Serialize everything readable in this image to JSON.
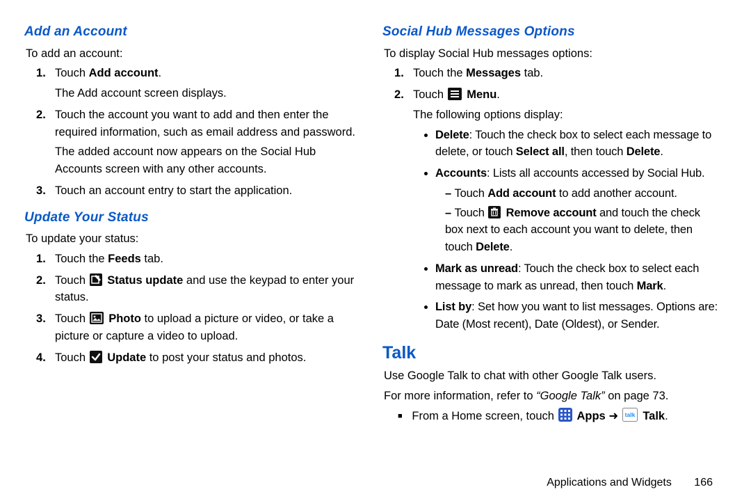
{
  "left": {
    "h_add_account": "Add an Account",
    "add_intro": "To add an account:",
    "add_1a": "Touch ",
    "add_1b": "Add account",
    "add_1c": ".",
    "add_1_follow": "The Add account screen displays.",
    "add_2": "Touch the account you want to add and then enter the required information, such as email address and password.",
    "add_2_follow": "The added account now appears on the Social Hub Accounts screen with any other accounts.",
    "add_3": "Touch an account entry to start the application.",
    "h_update": "Update Your Status",
    "upd_intro": "To update your status:",
    "upd_1a": "Touch the ",
    "upd_1b": "Feeds",
    "upd_1c": " tab.",
    "upd_2a": "Touch ",
    "upd_2b": " Status update",
    "upd_2c": " and use the keypad to enter your status.",
    "upd_3a": "Touch ",
    "upd_3b": " Photo",
    "upd_3c": " to upload a picture or video, or take a picture or capture a video to upload.",
    "upd_4a": "Touch ",
    "upd_4b": " Update",
    "upd_4c": " to post your status and photos."
  },
  "right": {
    "h_social": "Social Hub Messages Options",
    "soc_intro": "To display Social Hub messages options:",
    "soc_1a": "Touch the ",
    "soc_1b": "Messages",
    "soc_1c": " tab.",
    "soc_2a": "Touch ",
    "soc_2b": " Menu",
    "soc_2c": ".",
    "soc_2_follow": "The following options display:",
    "b_del_a": "Delete",
    "b_del_b": ": Touch the check box to select each message to delete, or touch ",
    "b_del_c": "Select all",
    "b_del_d": ", then touch ",
    "b_del_e": "Delete",
    "b_del_f": ".",
    "b_acc_a": "Accounts",
    "b_acc_b": ": Lists all accounts accessed by Social Hub.",
    "d_add_a": "Touch ",
    "d_add_b": "Add account",
    "d_add_c": " to add another account.",
    "d_rem_a": "Touch ",
    "d_rem_b": " Remove account",
    "d_rem_c": " and touch the check box next to each account you want to delete, then touch ",
    "d_rem_d": "Delete",
    "d_rem_e": ".",
    "b_mark_a": "Mark as unread",
    "b_mark_b": ": Touch the check box to select each message to mark as unread, then touch ",
    "b_mark_c": "Mark",
    "b_mark_d": ".",
    "b_list_a": "List by",
    "b_list_b": ": Set how you want to list messages. Options are: Date (Most recent), Date (Oldest), or Sender.",
    "h_talk": "Talk",
    "talk_p1": "Use Google Talk to chat with other Google Talk users.",
    "talk_p2a": "For more information, refer to ",
    "talk_p2b": "“Google Talk” ",
    "talk_p2c": " on page 73.",
    "talk_step_a": "From a Home screen, touch ",
    "talk_step_b": " Apps",
    "talk_step_c": " ➜ ",
    "talk_step_d": " Talk",
    "talk_step_e": "."
  },
  "footer": {
    "chapter": "Applications and Widgets",
    "page": "166"
  }
}
